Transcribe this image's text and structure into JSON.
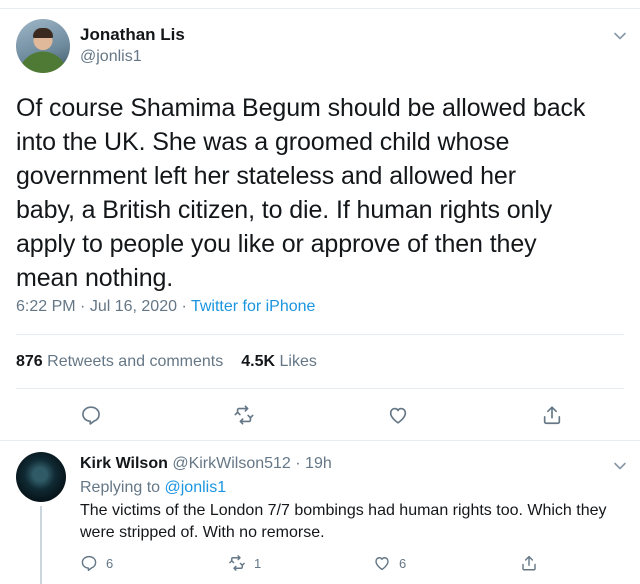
{
  "tweet": {
    "display_name": "Jonathan Lis",
    "handle": "@jonlis1",
    "text": "Of course Shamima Begum should be allowed back\ninto the UK. She was a groomed child whose\ngovernment left her stateless and allowed her\nbaby, a British citizen, to die. If human rights only\napply to people you like or approve of then they\nmean nothing.",
    "time": "6:22 PM",
    "sep1": " · ",
    "date": "Jul 16, 2020",
    "sep2": " · ",
    "source": "Twitter for iPhone",
    "retweets_count": "876",
    "retweets_label": "Retweets and comments",
    "likes_count": "4.5K",
    "likes_label": "Likes"
  },
  "reply": {
    "display_name": "Kirk Wilson",
    "handle": "@KirkWilson512",
    "sep": " · ",
    "age": "19h",
    "replying_label": "Replying to",
    "replying_to": "@jonlis1",
    "text": "The victims of the London 7/7 bombings had human rights too. Which they were stripped of. With no remorse.",
    "reply_count": "6",
    "retweet_count": "1",
    "like_count": "6"
  },
  "icons": {
    "chevron": "chevron-down-icon",
    "reply": "reply-icon",
    "retweet": "retweet-icon",
    "like": "heart-icon",
    "share": "share-icon"
  },
  "colors": {
    "link": "#1b95e0",
    "secondary": "#657786",
    "text": "#14171a",
    "divider": "#e6ecf0"
  }
}
